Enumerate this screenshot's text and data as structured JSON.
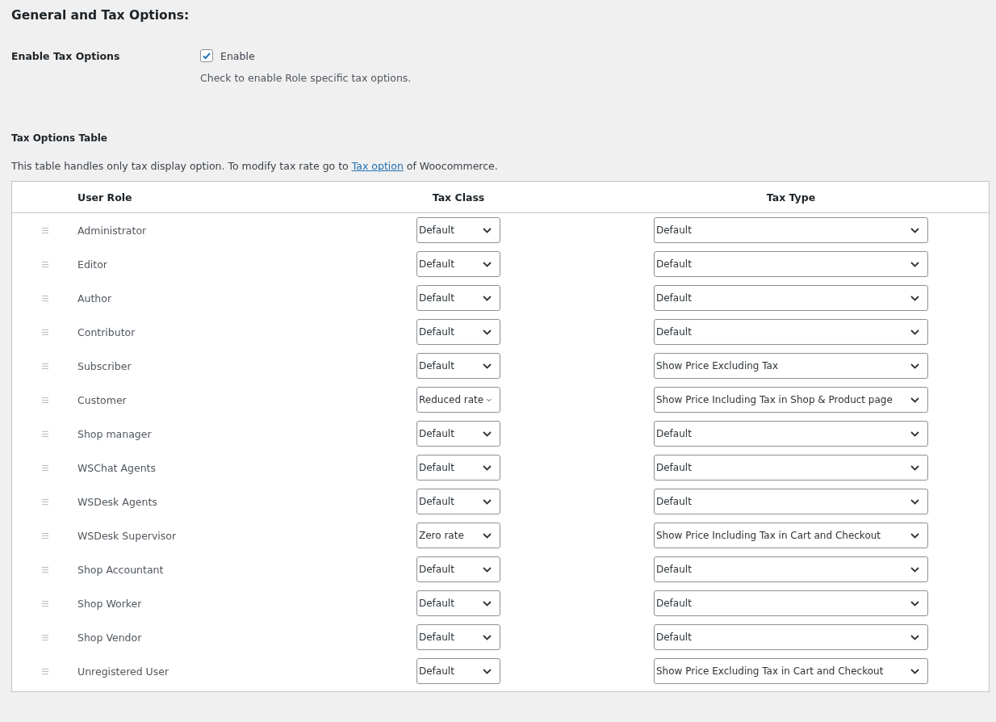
{
  "heading": "General and Tax Options:",
  "enable_tax_options": {
    "label": "Enable Tax Options",
    "checkbox_label": "Enable",
    "checked": true,
    "description": "Check to enable Role specific tax options."
  },
  "tax_options_table": {
    "title": "Tax Options Table",
    "note_before": "This table handles only tax display option. To modify tax rate go to ",
    "note_link": "Tax option",
    "note_after": " of Woocommerce.",
    "columns": [
      "User Role",
      "Tax Class",
      "Tax Type"
    ],
    "rows": [
      {
        "user_role": "Administrator",
        "tax_class": "Default",
        "tax_type": "Default"
      },
      {
        "user_role": "Editor",
        "tax_class": "Default",
        "tax_type": "Default"
      },
      {
        "user_role": "Author",
        "tax_class": "Default",
        "tax_type": "Default"
      },
      {
        "user_role": "Contributor",
        "tax_class": "Default",
        "tax_type": "Default"
      },
      {
        "user_role": "Subscriber",
        "tax_class": "Default",
        "tax_type": "Show Price Excluding Tax"
      },
      {
        "user_role": "Customer",
        "tax_class": "Reduced rate",
        "tax_type": "Show Price Including Tax in Shop & Product page"
      },
      {
        "user_role": "Shop manager",
        "tax_class": "Default",
        "tax_type": "Default"
      },
      {
        "user_role": "WSChat Agents",
        "tax_class": "Default",
        "tax_type": "Default"
      },
      {
        "user_role": "WSDesk Agents",
        "tax_class": "Default",
        "tax_type": "Default"
      },
      {
        "user_role": "WSDesk Supervisor",
        "tax_class": "Zero rate",
        "tax_type": "Show Price Including Tax in Cart and Checkout"
      },
      {
        "user_role": "Shop Accountant",
        "tax_class": "Default",
        "tax_type": "Default"
      },
      {
        "user_role": "Shop Worker",
        "tax_class": "Default",
        "tax_type": "Default"
      },
      {
        "user_role": "Shop Vendor",
        "tax_class": "Default",
        "tax_type": "Default"
      },
      {
        "user_role": "Unregistered User",
        "tax_class": "Default",
        "tax_type": "Show Price Excluding Tax in Cart and Checkout"
      }
    ]
  }
}
